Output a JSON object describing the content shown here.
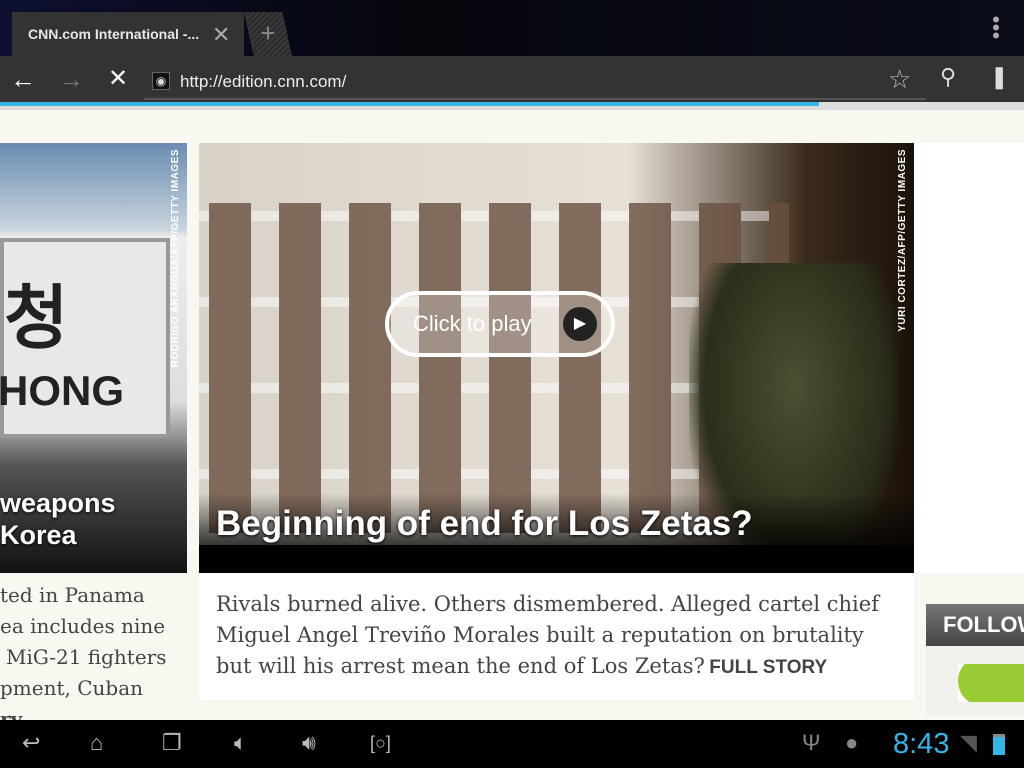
{
  "browser": {
    "tab_title": "CNN.com International -...",
    "url": "http://edition.cnn.com/",
    "load_progress": 0.8
  },
  "left_story": {
    "headline_line1": "weapons",
    "headline_line2": "Korea",
    "credit": "RODRIGO ARANGUA/AFP/GETTY IMAGES",
    "sign_text": "HONG",
    "body_lines": [
      "ted in Panama",
      "ea includes nine",
      "MiG-21 fighters",
      "pment, Cuban",
      "ry"
    ]
  },
  "main_story": {
    "headline": "Beginning of end for Los Zetas?",
    "credit": "YURI CORTEZ/AFP/GETTY IMAGES",
    "play_label": "Click to play",
    "body": "Rivals burned alive. Others dismembered. Alleged cartel chief Miguel Angel Treviño Morales built a reputation on brutality but will his arrest mean the end of Los Zetas?",
    "full_story": "FULL STORY"
  },
  "right_panel": {
    "follow_label": "FOLLOW"
  },
  "status": {
    "time": "8:43",
    "accent": "#33b5e5"
  }
}
